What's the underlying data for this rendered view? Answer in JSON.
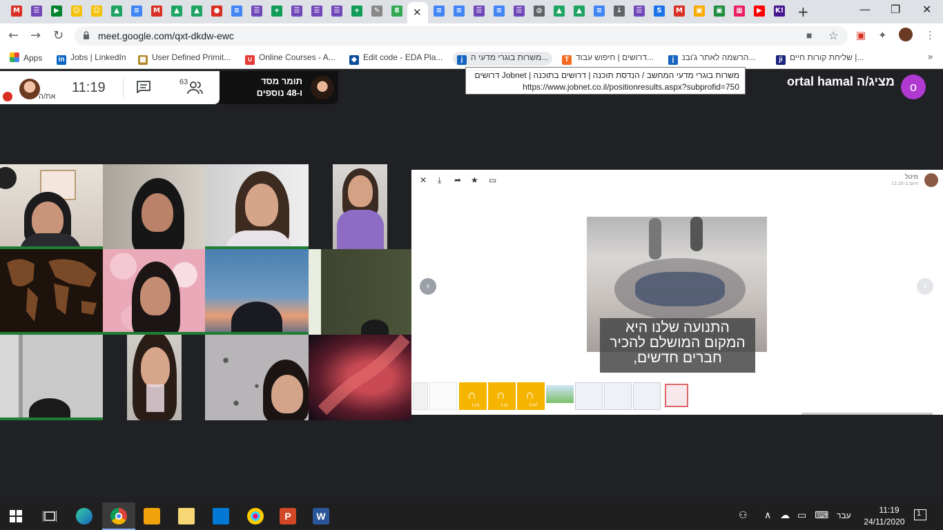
{
  "browser": {
    "tab_icons": [
      {
        "name": "gmail-icon",
        "color": "#d93025",
        "glyph": "M"
      },
      {
        "name": "forms-icon",
        "color": "#7248b9",
        "glyph": "☰"
      },
      {
        "name": "meet-icon",
        "color": "#00832d",
        "glyph": "▶"
      },
      {
        "name": "emoji-icon",
        "color": "#f4c20d",
        "glyph": "☺"
      },
      {
        "name": "emoji-icon",
        "color": "#f4c20d",
        "glyph": "☺"
      },
      {
        "name": "drive-icon",
        "color": "#1fa463",
        "glyph": "▲"
      },
      {
        "name": "docs-icon",
        "color": "#4285f4",
        "glyph": "≡"
      },
      {
        "name": "gmail-icon",
        "color": "#d93025",
        "glyph": "M"
      },
      {
        "name": "drive-icon",
        "color": "#1fa463",
        "glyph": "▲"
      },
      {
        "name": "drive-icon",
        "color": "#1fa463",
        "glyph": "▲"
      },
      {
        "name": "record-icon",
        "color": "#d93025",
        "glyph": "●"
      },
      {
        "name": "docs-icon",
        "color": "#4285f4",
        "glyph": "≡"
      },
      {
        "name": "forms-icon",
        "color": "#7248b9",
        "glyph": "☰"
      },
      {
        "name": "sheets-icon",
        "color": "#0f9d58",
        "glyph": "+"
      },
      {
        "name": "forms-icon",
        "color": "#7248b9",
        "glyph": "☰"
      },
      {
        "name": "forms-icon",
        "color": "#7248b9",
        "glyph": "☰"
      },
      {
        "name": "forms-icon",
        "color": "#7248b9",
        "glyph": "☰"
      },
      {
        "name": "sheets-icon",
        "color": "#0f9d58",
        "glyph": "+"
      },
      {
        "name": "notepad-icon",
        "color": "#888888",
        "glyph": "✎"
      },
      {
        "name": "counter-icon",
        "color": "#34a853",
        "glyph": "8"
      }
    ],
    "tab_icons_right": [
      {
        "name": "docs-icon",
        "color": "#4285f4",
        "glyph": "≡"
      },
      {
        "name": "docs-icon",
        "color": "#4285f4",
        "glyph": "≡"
      },
      {
        "name": "forms-icon",
        "color": "#7248b9",
        "glyph": "☰"
      },
      {
        "name": "docs-icon",
        "color": "#4285f4",
        "glyph": "≡"
      },
      {
        "name": "forms-icon",
        "color": "#7248b9",
        "glyph": "☰"
      },
      {
        "name": "globe-icon",
        "color": "#5f6368",
        "glyph": "◍"
      },
      {
        "name": "drive-icon",
        "color": "#1fa463",
        "glyph": "▲"
      },
      {
        "name": "drive-icon",
        "color": "#1fa463",
        "glyph": "▲"
      },
      {
        "name": "docs-icon",
        "color": "#4285f4",
        "glyph": "≡"
      },
      {
        "name": "download-icon",
        "color": "#5f6368",
        "glyph": "↓"
      },
      {
        "name": "forms-icon",
        "color": "#7248b9",
        "glyph": "☰"
      },
      {
        "name": "s-icon",
        "color": "#1a73e8",
        "glyph": "S"
      },
      {
        "name": "gmail-icon",
        "color": "#d93025",
        "glyph": "M"
      },
      {
        "name": "classroom-icon",
        "color": "#f9ab00",
        "glyph": "▣"
      },
      {
        "name": "classroom-icon",
        "color": "#1e8e3e",
        "glyph": "▣"
      },
      {
        "name": "photo-icon",
        "color": "#e91e63",
        "glyph": "▦"
      },
      {
        "name": "youtube-icon",
        "color": "#ff0000",
        "glyph": "▶"
      },
      {
        "name": "kahoot-icon",
        "color": "#46178f",
        "glyph": "K!"
      }
    ],
    "url": "meet.google.com/qxt-dkdw-ewc",
    "bookmarks": [
      {
        "label": "Apps",
        "icon": "apps-grid-icon",
        "color": "#ea4335"
      },
      {
        "label": "Jobs | LinkedIn",
        "icon": "linkedin-icon",
        "color": "#0a66c2",
        "glyph": "in"
      },
      {
        "label": "User Defined Primit...",
        "icon": "chip-icon",
        "color": "#444444",
        "glyph": "▦"
      },
      {
        "label": "Online Courses - A...",
        "icon": "udemy-icon",
        "color": "#e53935",
        "glyph": "∪"
      },
      {
        "label": "Edit code - EDA Pla...",
        "icon": "eda-icon",
        "color": "#0a4c9c",
        "glyph": "◆"
      },
      {
        "label": "משרות בוגרי מדעי ה...",
        "icon": "jobnet-icon",
        "color": "#1565c0",
        "glyph": "j"
      },
      {
        "label": "דרושים | חיפוש עבוד...",
        "icon": "t-icon",
        "color": "#f26b21",
        "glyph": "T"
      },
      {
        "label": "הרשמה לאתר ג'ובנ...",
        "icon": "jobnet-icon",
        "color": "#1565c0",
        "glyph": "j"
      },
      {
        "label": "שליחת קורות חיים |...",
        "icon": "ji-icon",
        "color": "#1a237e",
        "glyph": "ji"
      }
    ],
    "tooltip": {
      "line1": "משרות בוגרי מדעי המחשב / הנדסת תוכנה | דרושים בתוכנה | Jobnet דרושים",
      "line2": "https://www.jobnet.co.il/positionresults.aspx?subprofid=750"
    }
  },
  "meet": {
    "time": "11:19",
    "people_count": "63",
    "self_label": "את/ה",
    "pinned_name": "תומר מסד",
    "pinned_more": "ו-48 נוספים",
    "presenter_label": "ortal hamal מציג/ה",
    "presenter_initial": "o"
  },
  "share": {
    "user": "מיטל",
    "time": "היום ב-11:16",
    "caption_line1": "התנועה שלנו היא",
    "caption_line2": "המקום המושלם להכיר",
    "caption_line3": "חברים חדשים,",
    "thumbs": [
      {
        "name": "doc-thumb",
        "color": "#f1f1f1"
      },
      {
        "name": "doc-thumb",
        "color": "#f5f5f5"
      },
      {
        "name": "audio-thumb",
        "color": "#f5b400",
        "caption": "1:01"
      },
      {
        "name": "audio-thumb",
        "color": "#f5b400",
        "caption": "1:11"
      },
      {
        "name": "audio-thumb",
        "color": "#f5b400",
        "caption": "0:47"
      },
      {
        "name": "landscape-thumb",
        "color": "#6bb86b"
      },
      {
        "name": "screenshot-thumb",
        "color": "#e8eef5"
      },
      {
        "name": "screenshot-thumb",
        "color": "#e8eef5"
      },
      {
        "name": "screenshot-thumb",
        "color": "#e8eef5"
      },
      {
        "name": "certificate-thumb",
        "color": "#f7e8ec"
      }
    ]
  },
  "taskbar": {
    "time": "11:19",
    "date": "24/11/2020",
    "language": "עבר",
    "notifications": "1"
  }
}
